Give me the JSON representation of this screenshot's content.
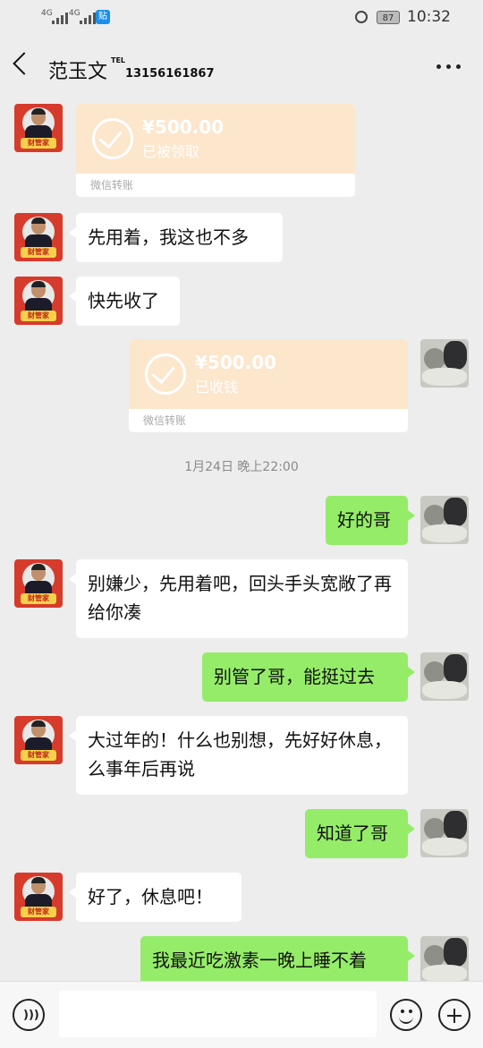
{
  "status_bar": {
    "sim1": "4G",
    "sim2": "4G",
    "app_badge": "贴",
    "battery": "87",
    "time": "10:32"
  },
  "header": {
    "title": "范玉文",
    "tel_tag": "TEL",
    "phone": "13156161867"
  },
  "avatar_tag": "财管家",
  "messages": [
    {
      "type": "transfer",
      "side": "left",
      "amount": "¥500.00",
      "status": "已被领取",
      "source": "微信转账"
    },
    {
      "type": "text",
      "side": "left",
      "text": "先用着，我这也不多"
    },
    {
      "type": "text",
      "side": "left",
      "text": "快先收了"
    },
    {
      "type": "transfer",
      "side": "right",
      "amount": "¥500.00",
      "status": "已收钱",
      "source": "微信转账"
    },
    {
      "type": "time",
      "text": "1月24日 晚上22:00"
    },
    {
      "type": "text",
      "side": "right",
      "text": "好的哥"
    },
    {
      "type": "text",
      "side": "left",
      "text": "别嫌少，先用着吧，回头手头宽敞了再给你凑"
    },
    {
      "type": "text",
      "side": "right",
      "text": "别管了哥，能挺过去"
    },
    {
      "type": "text",
      "side": "left",
      "text": "大过年的！什么也别想，先好好休息，么事年后再说"
    },
    {
      "type": "text",
      "side": "right",
      "text": "知道了哥"
    },
    {
      "type": "text",
      "side": "left",
      "text": "好了，休息吧！"
    },
    {
      "type": "text",
      "side": "right",
      "text": "我最近吃激素一晚上睡不着"
    }
  ],
  "input_bar": {
    "voice_icon": "voice-icon",
    "emoji_icon": "emoji-icon",
    "plus_icon": "plus-icon"
  }
}
